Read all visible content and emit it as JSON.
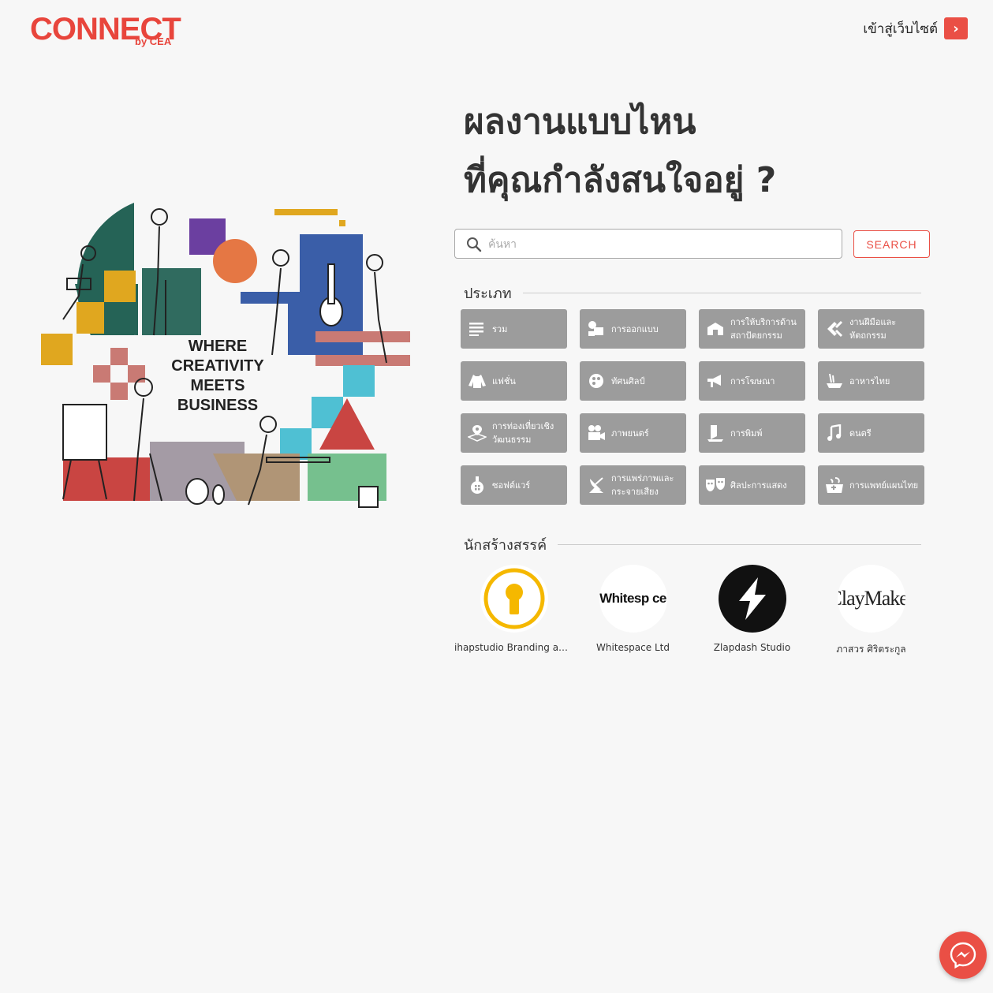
{
  "header": {
    "logo_text": "CONNECT",
    "logo_sub": "by CEA",
    "visit_label": "เข้าสู่เว็บไซต์",
    "visit_icon": "chevron-right-icon"
  },
  "illustration": {
    "tagline_lines": [
      "WHERE",
      "CREATIVITY",
      "MEETS",
      "BUSINESS"
    ]
  },
  "heading": {
    "line1": "ผลงานแบบไหน",
    "line2": "ที่คุณกำลังสนใจอยู่ ?"
  },
  "search": {
    "placeholder": "ค้นหา",
    "value": "",
    "button_label": "SEARCH",
    "icon": "search-icon"
  },
  "categories": {
    "title": "ประเภท",
    "items": [
      {
        "label": "รวม",
        "icon": "list-icon"
      },
      {
        "label": "การออกแบบ",
        "icon": "design-icon"
      },
      {
        "label": "การให้บริการด้านสถาปัตยกรรม",
        "icon": "architecture-icon"
      },
      {
        "label": "งานฝีมือและหัตถกรรม",
        "icon": "craft-icon"
      },
      {
        "label": "แฟชั่น",
        "icon": "fashion-icon"
      },
      {
        "label": "ทัศนศิลป์",
        "icon": "visual-art-icon"
      },
      {
        "label": "การโฆษณา",
        "icon": "megaphone-icon"
      },
      {
        "label": "อาหารไทย",
        "icon": "thai-food-icon"
      },
      {
        "label": "การท่องเที่ยวเชิงวัฒนธรรม",
        "icon": "map-pin-icon"
      },
      {
        "label": "ภาพยนตร์",
        "icon": "film-camera-icon"
      },
      {
        "label": "การพิมพ์",
        "icon": "printing-icon"
      },
      {
        "label": "ดนตรี",
        "icon": "music-note-icon"
      },
      {
        "label": "ซอฟต์แวร์",
        "icon": "software-icon"
      },
      {
        "label": "การแพร่ภาพและกระจายเสียง",
        "icon": "broadcast-icon"
      },
      {
        "label": "ศิลปะการแสดง",
        "icon": "theater-masks-icon"
      },
      {
        "label": "การแพทย์แผนไทย",
        "icon": "thai-medicine-icon"
      }
    ]
  },
  "creators": {
    "title": "นักสร้างสรรค์",
    "items": [
      {
        "name": "ihapstudio Branding and Design Studio",
        "logo": "keyhole-logo"
      },
      {
        "name": "Whitespace Ltd",
        "logo": "whitespace-logo",
        "logo_text": "Whitesp ce"
      },
      {
        "name": "Zlapdash Studio",
        "logo": "lightning-logo"
      },
      {
        "name": "ภาสวร ศิริตระกูล",
        "logo": "claymaker-logo",
        "logo_text": "ClayMaker"
      }
    ]
  },
  "messenger": {
    "icon": "messenger-icon"
  }
}
